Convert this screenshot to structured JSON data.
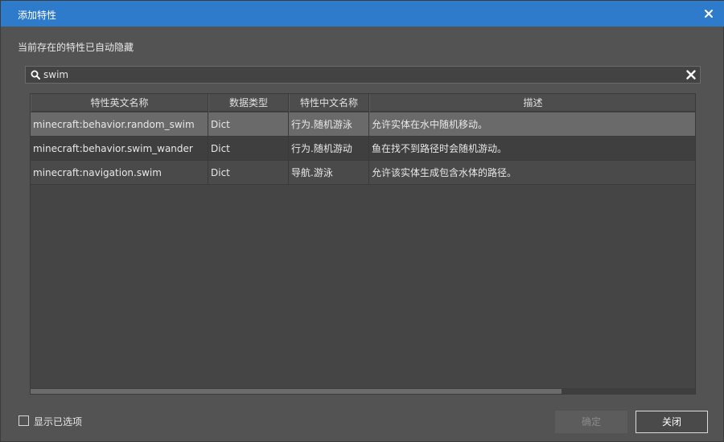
{
  "window": {
    "title": "添加特性",
    "close_icon": "close-icon"
  },
  "hint": "当前存在的特性已自动隐藏",
  "search": {
    "value": "swim",
    "icon": "search-icon",
    "clear_icon": "clear-icon"
  },
  "table": {
    "columns": [
      "特性英文名称",
      "数据类型",
      "特性中文名称",
      "描述"
    ],
    "rows": [
      [
        "minecraft:behavior.random_swim",
        "Dict",
        "行为.随机游泳",
        "允许实体在水中随机移动。"
      ],
      [
        "minecraft:behavior.swim_wander",
        "Dict",
        "行为.随机游动",
        "鱼在找不到路径时会随机游动。"
      ],
      [
        "minecraft:navigation.swim",
        "Dict",
        "导航.游泳",
        "允许该实体生成包含水体的路径。"
      ]
    ],
    "selected_row": 0
  },
  "footer": {
    "show_selected_label": "显示已选项",
    "confirm_label": "确定",
    "close_label": "关闭"
  },
  "colors": {
    "titlebar": "#2e7bcb",
    "background": "#535353",
    "selected_row": "#6a6a6a"
  }
}
